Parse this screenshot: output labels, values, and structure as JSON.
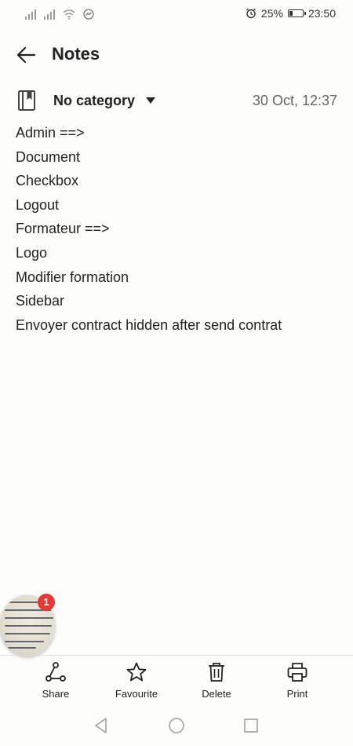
{
  "status_bar": {
    "battery_percent": "25%",
    "time": "23:50",
    "battery_level": 0.25
  },
  "header": {
    "title": "Notes",
    "back_icon": "arrow-left-icon"
  },
  "meta": {
    "category": "No category",
    "date": "30 Oct, 12:37"
  },
  "note": {
    "lines": [
      "Admin ==>",
      "Document",
      "Checkbox",
      "Logout",
      "Formateur ==>",
      "Logo",
      "Modifier formation",
      "Sidebar",
      "Envoyer contract hidden after send contrat"
    ]
  },
  "bubble": {
    "badge_count": "1"
  },
  "toolbar": {
    "share_label": "Share",
    "favourite_label": "Favourite",
    "delete_label": "Delete",
    "print_label": "Print"
  },
  "colors": {
    "background": "#fdfdfb",
    "text": "#222222",
    "date": "#666666",
    "badge": "#e53935"
  }
}
